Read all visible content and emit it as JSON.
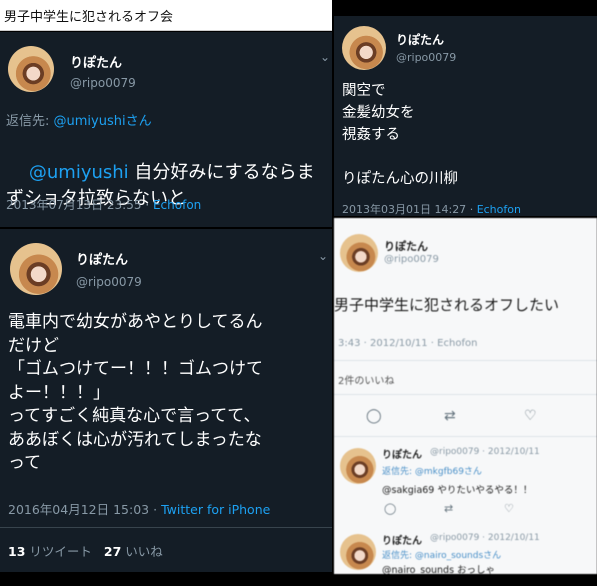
{
  "top_title": "男子中学生に犯されるオフ会",
  "panel_a": {
    "name": "りぽたん",
    "handle": "@ripo0079",
    "reply_to_label": "返信先:",
    "reply_to_user": "@umiyushiさん",
    "mention": "@umiyushi",
    "line1": " 自分好みにするならま",
    "line2": "ずショタ拉致らないと",
    "timestamp": "2013年07月13日 23:55",
    "sep": "·",
    "client": "Echofon"
  },
  "panel_b": {
    "name": "りぽたん",
    "handle": "@ripo0079",
    "text": "電車内で幼女があやとりしてるん\nだけど\n「ゴムつけてー！！！ゴムつけて\nよー！！！」\nってすごく純真な心で言ってて、\nああぼくは心が汚れてしまったな\nって",
    "timestamp": "2016年04月12日 15:03",
    "sep": "·",
    "client": "Twitter for iPhone",
    "retweets_count": "13",
    "retweets_label": "リツイート",
    "likes_count": "27",
    "likes_label": "いいね"
  },
  "panel_c": {
    "name": "りぽたん",
    "handle": "@ripo0079",
    "text": "関空で\n金髪幼女を\n視姦する\n\nりぽたん心の川柳",
    "timestamp": "2013年03月01日 14:27",
    "sep": "·",
    "client": "Echofon"
  },
  "panel_d": {
    "name": "りぽたん",
    "handle": "@ripo0079",
    "text": "男子中学生に犯されるオフしたい",
    "meta": "3:43 · 2012/10/11 · Echofon",
    "likes": "2件のいいね",
    "reply1": {
      "name": "りぽたん",
      "meta": "@ripo0079 · 2012/10/11",
      "reply_to": "返信先: @mkgfb69さん",
      "text": "@sakgia69 やりたいやるやる！！"
    },
    "reply2": {
      "name": "りぽたん",
      "meta": "@ripo0079 · 2012/10/11",
      "reply_to": "返信先: @nairo_soundsさん",
      "text": "@nairo_sounds おっしゃ"
    }
  },
  "icons": [
    "chevron-down-icon",
    "reply-icon",
    "retweet-icon",
    "heart-icon"
  ],
  "colors": {
    "dark_bg": "#141d26",
    "link_blue": "#1da1f2",
    "muted": "#8899a6"
  }
}
